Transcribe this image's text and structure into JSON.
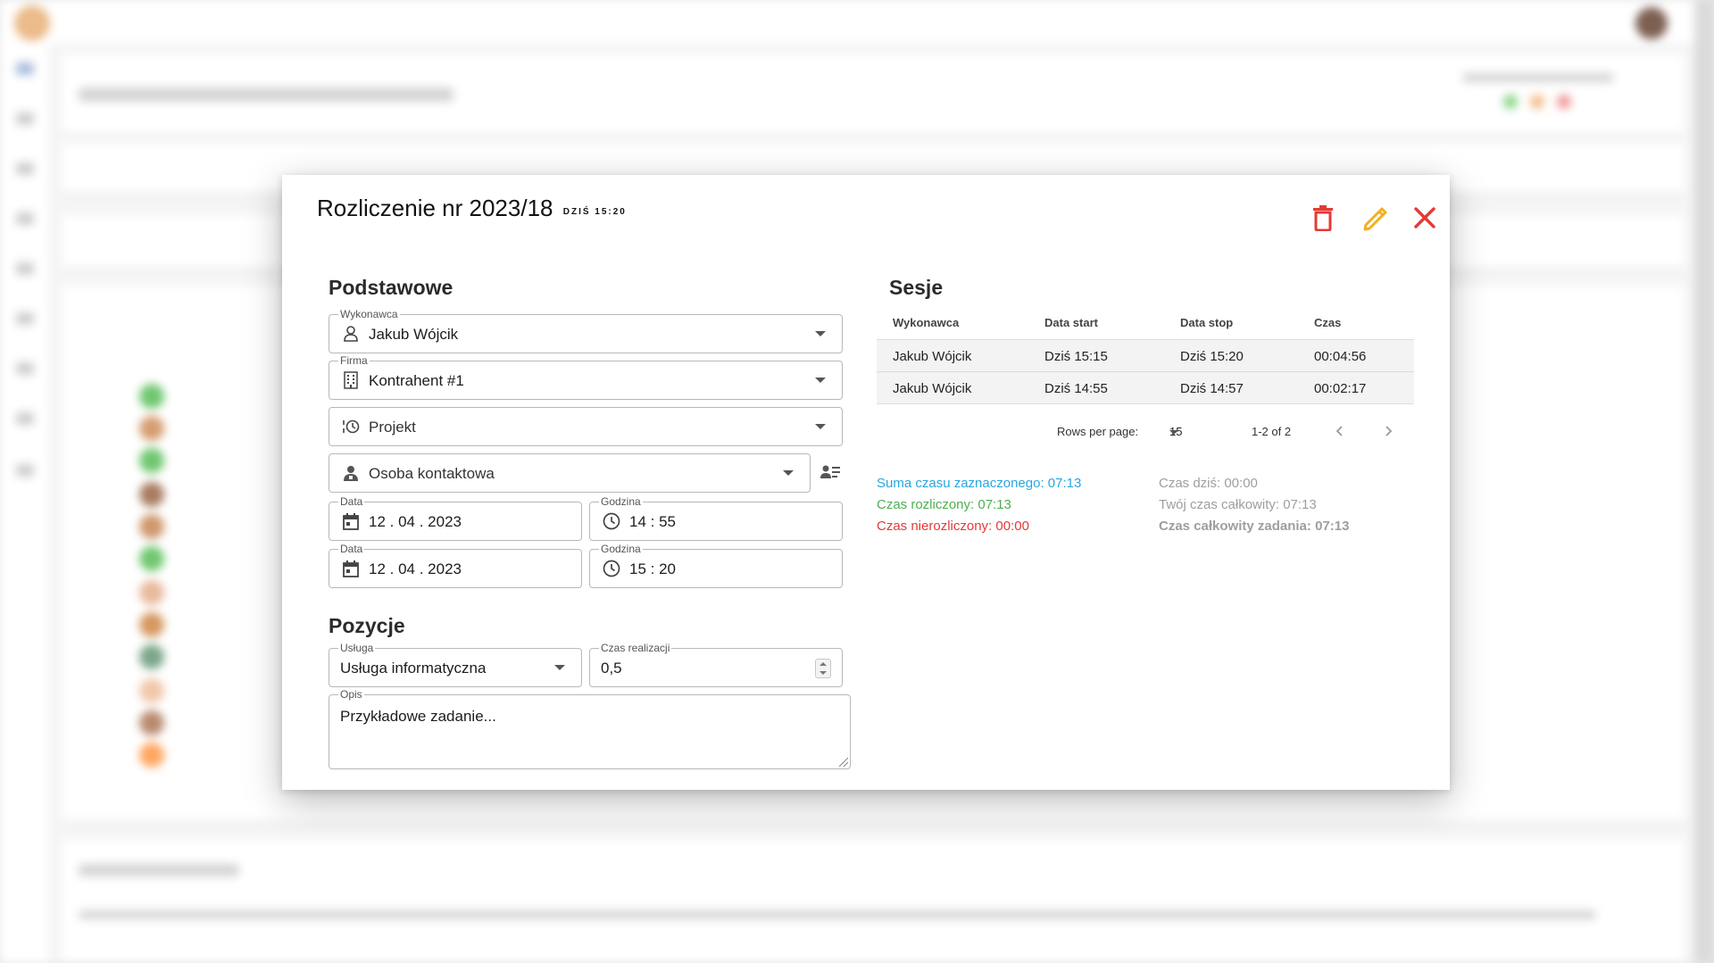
{
  "dialog": {
    "title": "Rozliczenie nr 2023/18",
    "timestamp": "DZIŚ 15:20",
    "colors": {
      "delete": "#e53935",
      "edit": "#f2b01e",
      "close": "#e53935"
    }
  },
  "basic": {
    "heading": "Podstawowe",
    "executor": {
      "label": "Wykonawca",
      "value": "Jakub Wójcik"
    },
    "company": {
      "label": "Firma",
      "value": "Kontrahent #1"
    },
    "project": {
      "placeholder": "Projekt"
    },
    "contact": {
      "placeholder": "Osoba kontaktowa"
    },
    "start_date": {
      "label": "Data",
      "value": "12 . 04 . 2023"
    },
    "start_time": {
      "label": "Godzina",
      "value": "14 : 55"
    },
    "end_date": {
      "label": "Data",
      "value": "12 . 04 . 2023"
    },
    "end_time": {
      "label": "Godzina",
      "value": "15 : 20"
    }
  },
  "positions": {
    "heading": "Pozycje",
    "service": {
      "label": "Usługa",
      "value": "Usługa informatyczna"
    },
    "duration": {
      "label": "Czas realizacji",
      "value": "0,5"
    },
    "description": {
      "label": "Opis",
      "value": "Przykładowe zadanie..."
    }
  },
  "sessions": {
    "heading": "Sesje",
    "columns": [
      "Wykonawca",
      "Data start",
      "Data stop",
      "Czas"
    ],
    "rows": [
      [
        "Jakub Wójcik",
        "Dziś 15:15",
        "Dziś 15:20",
        "00:04:56"
      ],
      [
        "Jakub Wójcik",
        "Dziś 14:55",
        "Dziś 14:57",
        "00:02:17"
      ]
    ],
    "rows_per_page_label": "Rows per page:",
    "rows_per_page": "15",
    "range": "1-2 of 2"
  },
  "stats": {
    "selected": "Suma czasu zaznaczonego: 07:13",
    "settled": "Czas rozliczony: 07:13",
    "unsettled": "Czas nierozliczony: 00:00",
    "today": "Czas dziś: 00:00",
    "your_total": "Twój czas całkowity: 07:13",
    "task_total": "Czas całkowity zadania: 07:13",
    "colors": {
      "selected": "#29a6df",
      "settled": "#4caf50",
      "unsettled": "#e53935",
      "muted": "#9e9e9e"
    }
  }
}
